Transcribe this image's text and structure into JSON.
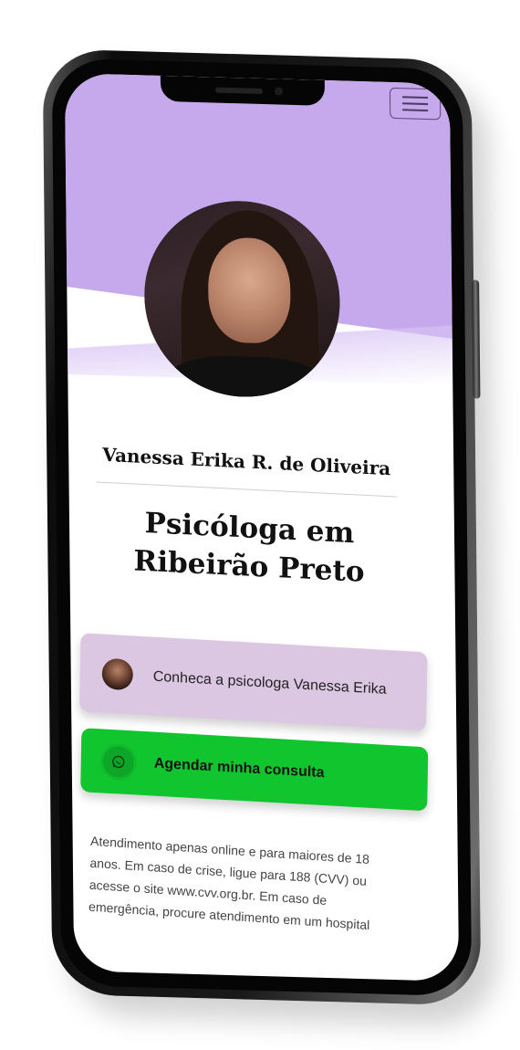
{
  "header": {
    "menu_icon": "hamburger-icon"
  },
  "profile": {
    "name": "Vanessa Erika R. de Oliveira",
    "headline": "Psicóloga em Ribeirão Preto"
  },
  "cards": {
    "about_label": "Conheca a psicologa Vanessa Erika",
    "whatsapp_label": "Agendar minha consulta",
    "whatsapp_icon": "whatsapp-icon"
  },
  "notice": {
    "text": "Atendimento apenas online e para maiores de 18 anos. Em caso de crise, ligue para 188 (CVV) ou acesse o site www.cvv.org.br. Em caso de emergência, procure atendimento em um hospital"
  },
  "colors": {
    "hero": "#c6a8ec",
    "about_card": "#dcc7e3",
    "whatsapp_card": "#10c52e"
  }
}
